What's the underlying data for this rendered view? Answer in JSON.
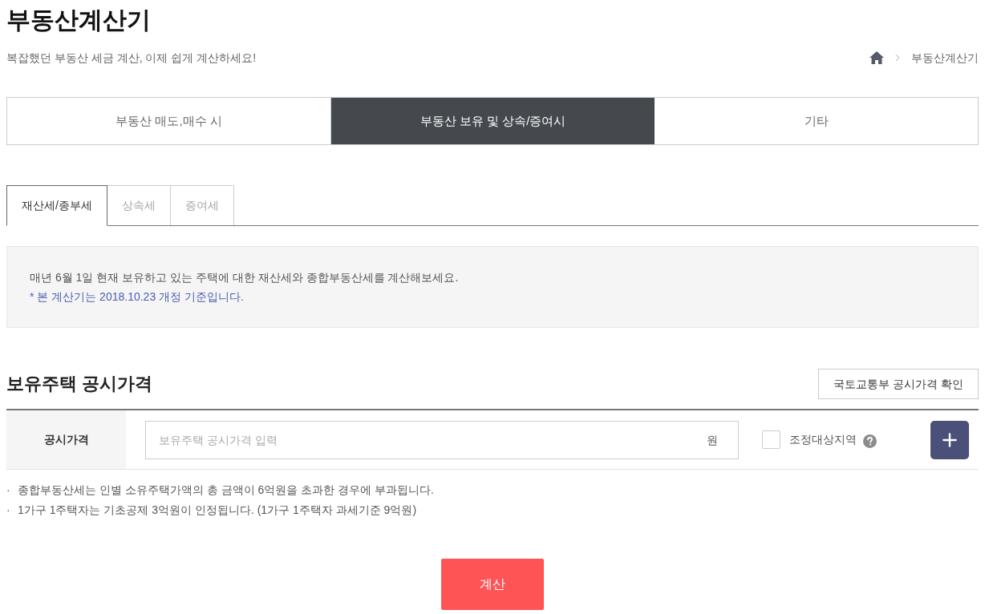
{
  "page": {
    "title": "부동산계산기",
    "subtitle": "복잡했던 부동산 세금 계산, 이제 쉽게 계산하세요!"
  },
  "breadcrumb": {
    "current": "부동산계산기"
  },
  "main_tabs": [
    {
      "label": "부동산 매도,매수 시",
      "selected": false
    },
    {
      "label": "부동산 보유 및 상속/증여시",
      "selected": true
    },
    {
      "label": "기타",
      "selected": false
    }
  ],
  "sub_tabs": [
    {
      "label": "재산세/종부세",
      "selected": true
    },
    {
      "label": "상속세",
      "selected": false
    },
    {
      "label": "증여세",
      "selected": false
    }
  ],
  "info": {
    "text": "매년 6월 1일 현재 보유하고 있는 주택에 대한 재산세와 종합부동산세를 계산해보세요.",
    "note": "* 본 계산기는 2018.10.23 개정 기준입니다."
  },
  "section": {
    "title": "보유주택 공시가격",
    "link_button": "국토교통부 공시가격 확인"
  },
  "price_row": {
    "label": "공시가격",
    "input": {
      "placeholder": "보유주택 공시가격 입력",
      "unit": "원"
    },
    "checkbox": {
      "label": "조정대상지역",
      "checked": false
    }
  },
  "notes": [
    {
      "bullet": "·",
      "text": "종합부동산세는 인별 소유주택가액의 총 금액이 6억원을 초과한 경우에 부과됩니다."
    },
    {
      "bullet": "·",
      "text": "1가구 1주택자는 기초공제 3억원이 인정됩니다. (1가구 1주택자 과세기준 9억원)"
    }
  ],
  "calculate_button": "계산"
}
